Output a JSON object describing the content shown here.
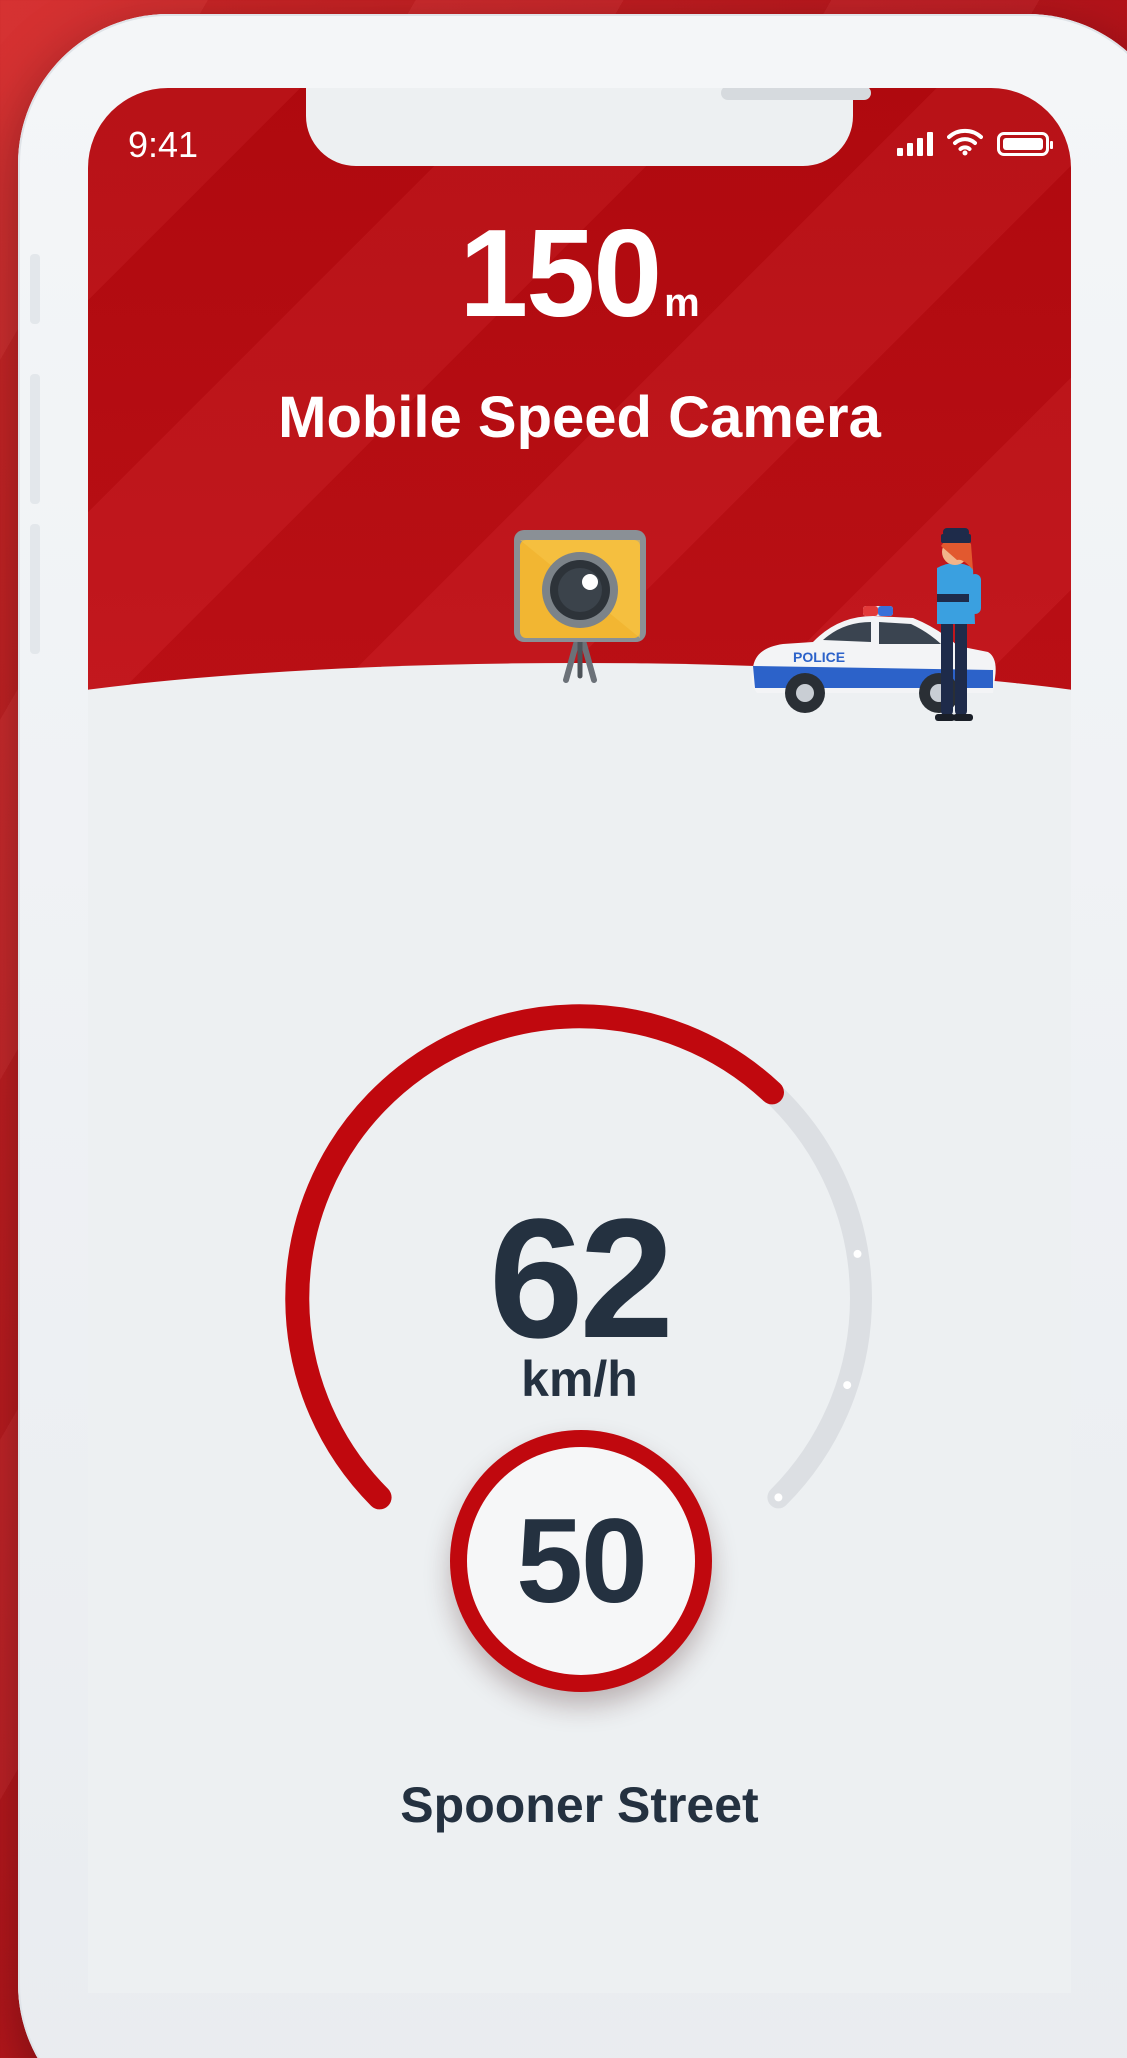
{
  "status_bar": {
    "time": "9:41"
  },
  "alert": {
    "distance_value": "150",
    "distance_unit": "m",
    "label": "Mobile Speed Camera",
    "police_car_text": "POLICE"
  },
  "speedometer": {
    "current_speed": "62",
    "unit": "km/h",
    "speed_limit": "50",
    "gauge_fill_fraction": 0.66
  },
  "location": {
    "street": "Spooner Street"
  },
  "colors": {
    "brand_red": "#c0080e",
    "text_dark": "#243140",
    "track_grey": "#dcdfe3",
    "camera_yellow": "#f2b632"
  }
}
